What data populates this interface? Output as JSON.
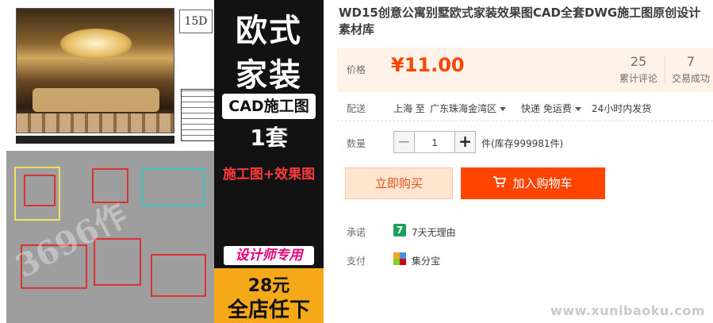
{
  "product": {
    "title": "WD15创意公寓别墅欧式家装效果图CAD全套DWG施工图原创设计素材库"
  },
  "gallery": {
    "logo_text": "15D",
    "watermark_text": "3696作",
    "promo": {
      "line1": "欧式",
      "line2": "家装",
      "cad_label": "CAD施工图",
      "set_label": "1套",
      "combo_label": "施工图+效果图",
      "designer_label": "设计师专用",
      "price_label": "28元",
      "store_label": "全店任下"
    }
  },
  "price_panel": {
    "label": "价格",
    "price": "¥11.00",
    "reviews": {
      "count": "25",
      "label": "累计评论"
    },
    "sales": {
      "count": "7",
      "label": "交易成功"
    }
  },
  "shipping": {
    "label": "配送",
    "from": "上海 至",
    "to": "广东珠海金湾区",
    "method": "快递 免运费",
    "dispatch": "24小时内发货"
  },
  "quantity": {
    "label": "数量",
    "value": "1",
    "minus": "−",
    "plus": "+",
    "stock": "件(库存999981件)"
  },
  "actions": {
    "buy_now": "立即购买",
    "add_to_cart": "加入购物车"
  },
  "promise": {
    "label": "承诺",
    "badge": "7",
    "text": "7天无理由"
  },
  "payment": {
    "label": "支付",
    "text": "集分宝"
  },
  "site_watermark": "www.xunibaoku.com",
  "colors": {
    "price": "#ff4400",
    "price_panel_bg": "#fff2e8",
    "add_cart_bg": "#ff4400",
    "buy_now_bg": "#ffe4d0",
    "promise_badge": "#1aa15c"
  }
}
